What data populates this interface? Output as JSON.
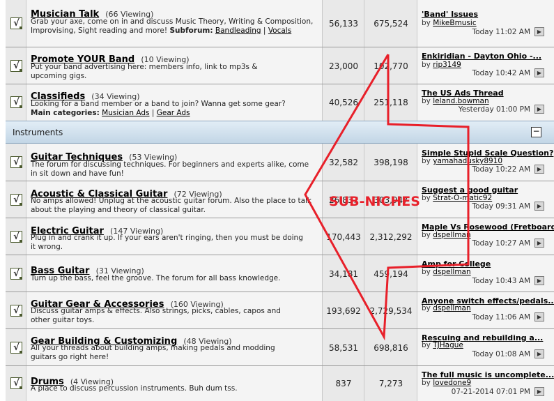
{
  "category": {
    "title": "Instruments",
    "collapse_symbol": "−"
  },
  "forums": [
    {
      "name": "Musician Talk",
      "viewing": "(66 Viewing)",
      "description": "Grab your axe, come on in and discuss Music Theory, Writing & Composition, Improvising, Sight reading and more!",
      "sub_label": "Subforum:",
      "sub_links": [
        "Bandleading",
        "Vocals"
      ],
      "threads": "56,133",
      "posts": "675,524",
      "last_title": "'Band' Issues",
      "last_by": "by",
      "last_user": "MikeBmusic",
      "last_date": "Today 11:02 AM"
    },
    {
      "name": "Promote YOUR Band",
      "viewing": "(10 Viewing)",
      "description": "Put your band advertising here: members info, link to mp3s & upcoming gigs.",
      "threads": "23,000",
      "posts": "102,770",
      "last_title": "Enkiridian - Dayton Ohio -...",
      "last_by": "by",
      "last_user": "rip3149",
      "last_date": "Today 10:42 AM"
    },
    {
      "name": "Classifieds",
      "viewing": "(34 Viewing)",
      "description": "Looking for a band member or a band to join? Wanna get some gear?",
      "sub_label": "Main categories:",
      "sub_links": [
        "Musician Ads",
        "Gear Ads"
      ],
      "threads": "40,526",
      "posts": "251,118",
      "last_title": "The US Ads Thread",
      "last_by": "by",
      "last_user": "leland.bowman",
      "last_date": "Yesterday 01:00 PM"
    },
    {
      "name": "Guitar Techniques",
      "viewing": "(53 Viewing)",
      "description": "The forum for discussing techniques. For beginners and experts alike, come in sit down and have fun!",
      "threads": "32,582",
      "posts": "398,198",
      "last_title": "Simple Stupid Scale Question?",
      "last_by": "by",
      "last_user": "yamahadusky8910",
      "last_date": "Today 10:22 AM"
    },
    {
      "name": "Acoustic & Classical Guitar",
      "viewing": "(72 Viewing)",
      "description": "No amps allowed! Unplug at the acoustic guitar forum. Also the place to talk about the playing and theory of classical guitar.",
      "threads": "26,837",
      "posts": "303,947",
      "last_title": "Suggest a good guitar",
      "last_by": "by",
      "last_user": "Strat-O-matic92",
      "last_date": "Today 09:31 AM"
    },
    {
      "name": "Electric Guitar",
      "viewing": "(147 Viewing)",
      "description": "Plug in and crank it up. If your ears aren't ringing, then you must be doing it wrong.",
      "threads": "170,443",
      "posts": "2,312,292",
      "last_title": "Maple Vs Rosewood (Fretboard)",
      "last_by": "by",
      "last_user": "dspellman",
      "last_date": "Today 10:27 AM"
    },
    {
      "name": "Bass Guitar",
      "viewing": "(31 Viewing)",
      "description": "Turn up the bass, feel the groove. The forum for all bass knowledge.",
      "threads": "34,181",
      "posts": "459,194",
      "last_title": "Amp for College",
      "last_by": "by",
      "last_user": "dspellman",
      "last_date": "Today 10:43 AM"
    },
    {
      "name": "Guitar Gear & Accessories",
      "viewing": "(160 Viewing)",
      "description": "Discuss guitar amps & effects. Also strings, picks, cables, capos and other guitar toys.",
      "threads": "193,692",
      "posts": "2,729,534",
      "last_title": "Anyone switch effects/pedals...",
      "last_by": "by",
      "last_user": "dspellman",
      "last_date": "Today 11:06 AM"
    },
    {
      "name": "Gear Building & Customizing",
      "viewing": "(48 Viewing)",
      "description": "All your threads about building amps, making pedals and modding guitars go right here!",
      "threads": "58,531",
      "posts": "698,816",
      "last_title": "Rescuing and rebuilding a...",
      "last_by": "by",
      "last_user": "TJHague",
      "last_date": "Today 01:08 AM"
    },
    {
      "name": "Drums",
      "viewing": "(4 Viewing)",
      "description": "A place to discuss percussion instruments. Buh dum tss.",
      "threads": "837",
      "posts": "7,273",
      "last_title": "The full music is uncomplete...",
      "last_by": "by",
      "last_user": "lovedone9",
      "last_date": "07-21-2014 07:01 PM"
    }
  ],
  "annotation": {
    "label": "SUB-NICHES",
    "color": "#e8202a"
  },
  "icons": {
    "forum_status": "forum-read-icon",
    "goto_last": "goto-last-post-icon",
    "collapse": "collapse-icon"
  },
  "colors": {
    "category_bar": "#c3d6e6",
    "annotation": "#e8202a"
  }
}
